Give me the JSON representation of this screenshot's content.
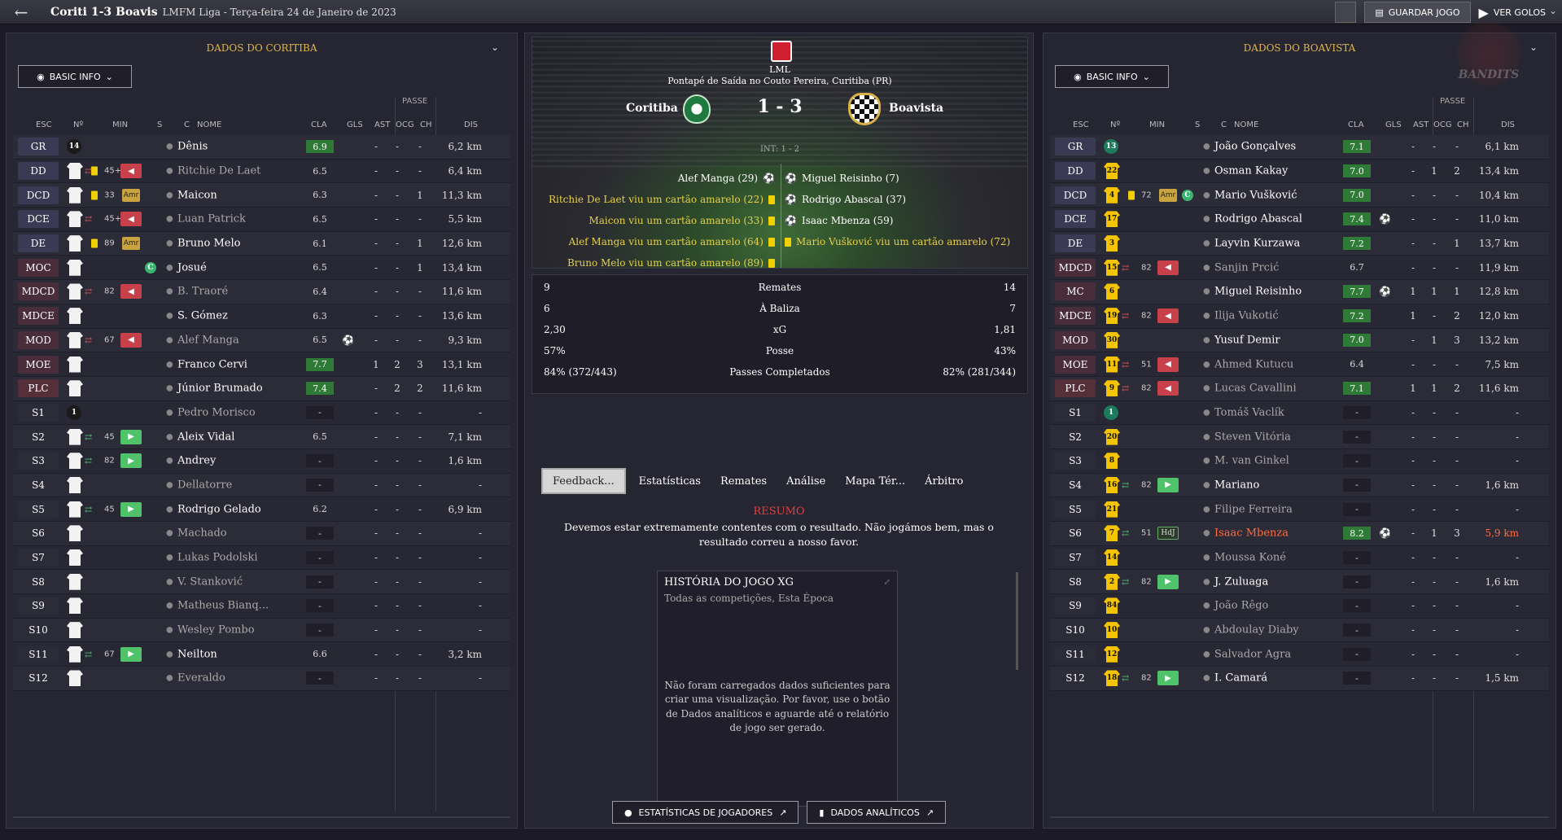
{
  "topbar": {
    "title": "Coriti 1-3 Boavis",
    "subtitle": "LMFM Liga  - Terça-feira 24 de Janeiro de 2023",
    "save_label": "GUARDAR JOGO",
    "goals_label": "VER GOLOS"
  },
  "left": {
    "header": "DADOS DO CORITIBA",
    "basic_info": "BASIC INFO",
    "passe": "PASSE",
    "columns": {
      "esc": "ESC",
      "n": "Nº",
      "min": "MIN",
      "s": "S",
      "c": "C",
      "nome": "NOME",
      "cla": "CLA",
      "gls": "GLS",
      "ast": "AST",
      "ocg": "OCG",
      "ch": "CH",
      "dis": "DIS"
    },
    "players": [
      {
        "pos": "GR",
        "n": "14",
        "shirt": "gk",
        "sub": "",
        "min": "",
        "s": "",
        "c": "",
        "name": "Dênis",
        "cla": "6.9",
        "gls": "",
        "ast": "-",
        "ocg": "-",
        "ch": "-",
        "dis": "6,2 km",
        "posc": "d",
        "rc": "g"
      },
      {
        "pos": "DD",
        "n": "",
        "shirt": "white",
        "sub": "out",
        "min": "45+4",
        "s": "red",
        "c": "",
        "name": "Ritchie De Laet",
        "cla": "6.5",
        "gls": "",
        "ast": "-",
        "ocg": "-",
        "ch": "-",
        "dis": "6,4 km",
        "posc": "d",
        "rc": "n",
        "yc": true,
        "dim": true
      },
      {
        "pos": "DCD",
        "n": "",
        "shirt": "white",
        "sub": "",
        "min": "33",
        "s": "amr",
        "c": "",
        "name": "Maicon",
        "cla": "6.3",
        "gls": "",
        "ast": "-",
        "ocg": "-",
        "ch": "1",
        "dis": "11,3 km",
        "posc": "d",
        "rc": "n",
        "yc": true
      },
      {
        "pos": "DCE",
        "n": "",
        "shirt": "white",
        "sub": "out",
        "min": "45+4",
        "s": "red",
        "c": "",
        "name": "Luan Patrick",
        "cla": "6.5",
        "gls": "",
        "ast": "-",
        "ocg": "-",
        "ch": "-",
        "dis": "5,5 km",
        "posc": "d",
        "rc": "n",
        "dim": true
      },
      {
        "pos": "DE",
        "n": "",
        "shirt": "white",
        "sub": "",
        "min": "89",
        "s": "amr",
        "c": "",
        "name": "Bruno Melo",
        "cla": "6.1",
        "gls": "",
        "ast": "-",
        "ocg": "-",
        "ch": "1",
        "dis": "12,6 km",
        "posc": "d",
        "rc": "n",
        "yc": true
      },
      {
        "pos": "MOC",
        "n": "",
        "shirt": "white",
        "sub": "",
        "min": "",
        "s": "",
        "c": "cap",
        "name": "Josué",
        "cla": "6.5",
        "gls": "",
        "ast": "-",
        "ocg": "-",
        "ch": "1",
        "dis": "13,4 km",
        "posc": "m",
        "rc": "n"
      },
      {
        "pos": "MDCD",
        "n": "",
        "shirt": "white",
        "sub": "out",
        "min": "82",
        "s": "red",
        "c": "",
        "name": "B. Traoré",
        "cla": "6.4",
        "gls": "",
        "ast": "-",
        "ocg": "-",
        "ch": "-",
        "dis": "11,6 km",
        "posc": "m",
        "rc": "n",
        "dim": true
      },
      {
        "pos": "MDCE",
        "n": "",
        "shirt": "white",
        "sub": "",
        "min": "",
        "s": "",
        "c": "",
        "name": "S. Gómez",
        "cla": "6.3",
        "gls": "",
        "ast": "-",
        "ocg": "-",
        "ch": "-",
        "dis": "13,6 km",
        "posc": "m",
        "rc": "n"
      },
      {
        "pos": "MOD",
        "n": "",
        "shirt": "white",
        "sub": "out",
        "min": "67",
        "s": "red",
        "c": "",
        "name": "Alef Manga",
        "cla": "6.5",
        "gls": "ball",
        "ast": "-",
        "ocg": "-",
        "ch": "-",
        "dis": "9,3 km",
        "posc": "m",
        "rc": "n",
        "dim": true
      },
      {
        "pos": "MOE",
        "n": "",
        "shirt": "white",
        "sub": "",
        "min": "",
        "s": "",
        "c": "",
        "name": "Franco Cervi",
        "cla": "7.7",
        "gls": "",
        "ast": "1",
        "ocg": "2",
        "ch": "3",
        "dis": "13,1 km",
        "posc": "m",
        "rc": "g"
      },
      {
        "pos": "PLC",
        "n": "",
        "shirt": "white",
        "sub": "",
        "min": "",
        "s": "",
        "c": "",
        "name": "Júnior Brumado",
        "cla": "7.4",
        "gls": "",
        "ast": "-",
        "ocg": "2",
        "ch": "2",
        "dis": "11,6 km",
        "posc": "a",
        "rc": "g"
      },
      {
        "pos": "S1",
        "n": "1",
        "shirt": "gk",
        "sub": "",
        "min": "",
        "s": "",
        "c": "",
        "name": "Pedro Morisco",
        "cla": "-",
        "gls": "",
        "ast": "-",
        "ocg": "-",
        "ch": "-",
        "dis": "-",
        "posc": "s",
        "rc": "dash",
        "dim": true
      },
      {
        "pos": "S2",
        "n": "",
        "shirt": "white",
        "sub": "in",
        "min": "45",
        "s": "green",
        "c": "",
        "name": "Aleix Vidal",
        "cla": "6.5",
        "gls": "",
        "ast": "-",
        "ocg": "-",
        "ch": "-",
        "dis": "7,1 km",
        "posc": "s",
        "rc": "n"
      },
      {
        "pos": "S3",
        "n": "",
        "shirt": "white",
        "sub": "in",
        "min": "82",
        "s": "green",
        "c": "",
        "name": "Andrey",
        "cla": "-",
        "gls": "",
        "ast": "-",
        "ocg": "-",
        "ch": "-",
        "dis": "1,6 km",
        "posc": "s",
        "rc": "dash"
      },
      {
        "pos": "S4",
        "n": "",
        "shirt": "white",
        "sub": "",
        "min": "",
        "s": "",
        "c": "",
        "name": "Dellatorre",
        "cla": "-",
        "gls": "",
        "ast": "-",
        "ocg": "-",
        "ch": "-",
        "dis": "-",
        "posc": "s",
        "rc": "dash",
        "dim": true
      },
      {
        "pos": "S5",
        "n": "",
        "shirt": "white",
        "sub": "in",
        "min": "45",
        "s": "green",
        "c": "",
        "name": "Rodrigo Gelado",
        "cla": "6.2",
        "gls": "",
        "ast": "-",
        "ocg": "-",
        "ch": "-",
        "dis": "6,9 km",
        "posc": "s",
        "rc": "n"
      },
      {
        "pos": "S6",
        "n": "",
        "shirt": "white",
        "sub": "",
        "min": "",
        "s": "",
        "c": "",
        "name": "Machado",
        "cla": "-",
        "gls": "",
        "ast": "-",
        "ocg": "-",
        "ch": "-",
        "dis": "-",
        "posc": "s",
        "rc": "dash",
        "dim": true
      },
      {
        "pos": "S7",
        "n": "",
        "shirt": "white",
        "sub": "",
        "min": "",
        "s": "",
        "c": "",
        "name": "Lukas Podolski",
        "cla": "-",
        "gls": "",
        "ast": "-",
        "ocg": "-",
        "ch": "-",
        "dis": "-",
        "posc": "s",
        "rc": "dash",
        "dim": true
      },
      {
        "pos": "S8",
        "n": "",
        "shirt": "white",
        "sub": "",
        "min": "",
        "s": "",
        "c": "",
        "name": "V. Stanković",
        "cla": "-",
        "gls": "",
        "ast": "-",
        "ocg": "-",
        "ch": "-",
        "dis": "-",
        "posc": "s",
        "rc": "dash",
        "dim": true
      },
      {
        "pos": "S9",
        "n": "",
        "shirt": "white",
        "sub": "",
        "min": "",
        "s": "",
        "c": "",
        "name": "Matheus Bianq...",
        "cla": "-",
        "gls": "",
        "ast": "-",
        "ocg": "-",
        "ch": "-",
        "dis": "-",
        "posc": "s",
        "rc": "dash",
        "dim": true
      },
      {
        "pos": "S10",
        "n": "",
        "shirt": "white",
        "sub": "",
        "min": "",
        "s": "",
        "c": "",
        "name": "Wesley Pombo",
        "cla": "-",
        "gls": "",
        "ast": "-",
        "ocg": "-",
        "ch": "-",
        "dis": "-",
        "posc": "s",
        "rc": "dash",
        "dim": true
      },
      {
        "pos": "S11",
        "n": "",
        "shirt": "white",
        "sub": "in",
        "min": "67",
        "s": "green",
        "c": "",
        "name": "Neilton",
        "cla": "6.6",
        "gls": "",
        "ast": "-",
        "ocg": "-",
        "ch": "-",
        "dis": "3,2 km",
        "posc": "s",
        "rc": "n"
      },
      {
        "pos": "S12",
        "n": "",
        "shirt": "white",
        "sub": "",
        "min": "",
        "s": "",
        "c": "",
        "name": "Everaldo",
        "cla": "-",
        "gls": "",
        "ast": "-",
        "ocg": "-",
        "ch": "-",
        "dis": "-",
        "posc": "s",
        "rc": "dash",
        "dim": true
      }
    ]
  },
  "right": {
    "header": "DADOS DO BOAVISTA",
    "basic_info": "BASIC INFO",
    "passe": "PASSE",
    "players": [
      {
        "pos": "GR",
        "n": "13",
        "shirt": "gk-green",
        "sub": "",
        "min": "",
        "s": "",
        "c": "",
        "name": "João Gonçalves",
        "cla": "7.1",
        "gls": "",
        "ast": "-",
        "ocg": "-",
        "ch": "-",
        "dis": "6,1 km",
        "posc": "d",
        "rc": "g"
      },
      {
        "pos": "DD",
        "n": "22",
        "shirt": "yellow",
        "sub": "",
        "min": "",
        "s": "",
        "c": "",
        "name": "Osman Kakay",
        "cla": "7.0",
        "gls": "",
        "ast": "-",
        "ocg": "1",
        "ch": "2",
        "dis": "13,4 km",
        "posc": "d",
        "rc": "g"
      },
      {
        "pos": "DCD",
        "n": "4",
        "shirt": "yellow",
        "sub": "",
        "min": "72",
        "s": "amr",
        "c": "cap",
        "name": "Mario Vušković",
        "cla": "7.0",
        "gls": "",
        "ast": "-",
        "ocg": "-",
        "ch": "-",
        "dis": "10,4 km",
        "posc": "d",
        "rc": "g",
        "yc": true
      },
      {
        "pos": "DCE",
        "n": "17",
        "shirt": "yellow",
        "sub": "",
        "min": "",
        "s": "",
        "c": "",
        "name": "Rodrigo Abascal",
        "cla": "7.4",
        "gls": "ball",
        "ast": "-",
        "ocg": "-",
        "ch": "-",
        "dis": "11,0 km",
        "posc": "d",
        "rc": "g"
      },
      {
        "pos": "DE",
        "n": "3",
        "shirt": "yellow",
        "sub": "",
        "min": "",
        "s": "",
        "c": "",
        "name": "Layvin Kurzawa",
        "cla": "7.2",
        "gls": "",
        "ast": "-",
        "ocg": "-",
        "ch": "1",
        "dis": "13,7 km",
        "posc": "d",
        "rc": "g"
      },
      {
        "pos": "MDCD",
        "n": "15",
        "shirt": "yellow",
        "sub": "out",
        "min": "82",
        "s": "red",
        "c": "",
        "name": "Sanjin Prcić",
        "cla": "6.7",
        "gls": "",
        "ast": "-",
        "ocg": "-",
        "ch": "-",
        "dis": "11,9 km",
        "posc": "m",
        "rc": "n",
        "dim": true
      },
      {
        "pos": "MC",
        "n": "6",
        "shirt": "yellow",
        "sub": "",
        "min": "",
        "s": "",
        "c": "",
        "name": "Miguel Reisinho",
        "cla": "7.7",
        "gls": "ball",
        "ast": "1",
        "ocg": "1",
        "ch": "1",
        "dis": "12,8 km",
        "posc": "m",
        "rc": "g"
      },
      {
        "pos": "MDCE",
        "n": "19",
        "shirt": "yellow",
        "sub": "out",
        "min": "82",
        "s": "red",
        "c": "",
        "name": "Ilija Vukotić",
        "cla": "7.2",
        "gls": "",
        "ast": "1",
        "ocg": "-",
        "ch": "2",
        "dis": "12,0 km",
        "posc": "m",
        "rc": "g",
        "dim": true
      },
      {
        "pos": "MOD",
        "n": "30",
        "shirt": "yellow",
        "sub": "",
        "min": "",
        "s": "",
        "c": "",
        "name": "Yusuf Demir",
        "cla": "7.0",
        "gls": "",
        "ast": "-",
        "ocg": "1",
        "ch": "3",
        "dis": "13,2 km",
        "posc": "m",
        "rc": "g"
      },
      {
        "pos": "MOE",
        "n": "11",
        "shirt": "yellow",
        "sub": "out",
        "min": "51",
        "s": "red",
        "c": "",
        "name": "Ahmed Kutucu",
        "cla": "6.4",
        "gls": "",
        "ast": "-",
        "ocg": "-",
        "ch": "-",
        "dis": "7,5 km",
        "posc": "m",
        "rc": "n",
        "dim": true
      },
      {
        "pos": "PLC",
        "n": "9",
        "shirt": "yellow",
        "sub": "out",
        "min": "82",
        "s": "red",
        "c": "",
        "name": "Lucas Cavallini",
        "cla": "7.1",
        "gls": "",
        "ast": "1",
        "ocg": "1",
        "ch": "2",
        "dis": "11,6 km",
        "posc": "a",
        "rc": "g",
        "dim": true
      },
      {
        "pos": "S1",
        "n": "1",
        "shirt": "gk-green",
        "sub": "",
        "min": "",
        "s": "",
        "c": "",
        "name": "Tomáš Vaclík",
        "cla": "-",
        "gls": "",
        "ast": "-",
        "ocg": "-",
        "ch": "-",
        "dis": "-",
        "posc": "s",
        "rc": "dash",
        "dim": true
      },
      {
        "pos": "S2",
        "n": "20",
        "shirt": "yellow",
        "sub": "",
        "min": "",
        "s": "",
        "c": "",
        "name": "Steven Vitória",
        "cla": "-",
        "gls": "",
        "ast": "-",
        "ocg": "-",
        "ch": "-",
        "dis": "-",
        "posc": "s",
        "rc": "dash",
        "dim": true
      },
      {
        "pos": "S3",
        "n": "8",
        "shirt": "yellow",
        "sub": "",
        "min": "",
        "s": "",
        "c": "",
        "name": "M. van Ginkel",
        "cla": "-",
        "gls": "",
        "ast": "-",
        "ocg": "-",
        "ch": "-",
        "dis": "-",
        "posc": "s",
        "rc": "dash",
        "dim": true
      },
      {
        "pos": "S4",
        "n": "16",
        "shirt": "yellow",
        "sub": "in",
        "min": "82",
        "s": "green",
        "c": "",
        "name": "Mariano",
        "cla": "-",
        "gls": "",
        "ast": "-",
        "ocg": "-",
        "ch": "-",
        "dis": "1,6 km",
        "posc": "s",
        "rc": "dash"
      },
      {
        "pos": "S5",
        "n": "21",
        "shirt": "yellow",
        "sub": "",
        "min": "",
        "s": "",
        "c": "",
        "name": "Filipe Ferreira",
        "cla": "-",
        "gls": "",
        "ast": "-",
        "ocg": "-",
        "ch": "-",
        "dis": "-",
        "posc": "s",
        "rc": "dash",
        "dim": true
      },
      {
        "pos": "S6",
        "n": "7",
        "shirt": "yellow",
        "sub": "in",
        "min": "51",
        "s": "hdj",
        "c": "",
        "name": "Isaac Mbenza",
        "cla": "8.2",
        "gls": "ball",
        "ast": "-",
        "ocg": "1",
        "ch": "3",
        "dis": "5,9 km",
        "posc": "s",
        "rc": "g",
        "red": true
      },
      {
        "pos": "S7",
        "n": "14",
        "shirt": "yellow",
        "sub": "",
        "min": "",
        "s": "",
        "c": "",
        "name": "Moussa Koné",
        "cla": "-",
        "gls": "",
        "ast": "-",
        "ocg": "-",
        "ch": "-",
        "dis": "-",
        "posc": "s",
        "rc": "dash",
        "dim": true
      },
      {
        "pos": "S8",
        "n": "2",
        "shirt": "yellow",
        "sub": "in",
        "min": "82",
        "s": "green",
        "c": "",
        "name": "J. Zuluaga",
        "cla": "-",
        "gls": "",
        "ast": "-",
        "ocg": "-",
        "ch": "-",
        "dis": "1,6 km",
        "posc": "s",
        "rc": "dash"
      },
      {
        "pos": "S9",
        "n": "84",
        "shirt": "yellow",
        "sub": "",
        "min": "",
        "s": "",
        "c": "",
        "name": "João Rêgo",
        "cla": "-",
        "gls": "",
        "ast": "-",
        "ocg": "-",
        "ch": "-",
        "dis": "-",
        "posc": "s",
        "rc": "dash",
        "dim": true
      },
      {
        "pos": "S10",
        "n": "10",
        "shirt": "yellow",
        "sub": "",
        "min": "",
        "s": "",
        "c": "",
        "name": "Abdoulay Diaby",
        "cla": "-",
        "gls": "",
        "ast": "-",
        "ocg": "-",
        "ch": "-",
        "dis": "-",
        "posc": "s",
        "rc": "dash",
        "dim": true
      },
      {
        "pos": "S11",
        "n": "12",
        "shirt": "yellow",
        "sub": "",
        "min": "",
        "s": "",
        "c": "",
        "name": "Salvador Agra",
        "cla": "-",
        "gls": "",
        "ast": "-",
        "ocg": "-",
        "ch": "-",
        "dis": "-",
        "posc": "s",
        "rc": "dash",
        "dim": true
      },
      {
        "pos": "S12",
        "n": "18",
        "shirt": "yellow",
        "sub": "in",
        "min": "82",
        "s": "green",
        "c": "",
        "name": "I. Camará",
        "cla": "-",
        "gls": "",
        "ast": "-",
        "ocg": "-",
        "ch": "-",
        "dis": "1,5 km",
        "posc": "s",
        "rc": "dash"
      }
    ]
  },
  "match": {
    "league": "LML",
    "kickoff": "Pontapé de Saída no Couto Pereira, Curitiba (PR)",
    "home": "Coritiba",
    "away": "Boavista",
    "score": "1 - 3",
    "ht": "INT: 1 - 2",
    "events_home": [
      {
        "text": "Alef Manga (29)",
        "type": "goal"
      },
      {
        "text": "Ritchie De Laet viu um cartão amarelo (22)",
        "type": "card"
      },
      {
        "text": "Maicon viu um cartão amarelo (33)",
        "type": "card"
      },
      {
        "text": "Alef Manga viu um cartão amarelo (64)",
        "type": "card"
      },
      {
        "text": "Bruno Melo viu um cartão amarelo (89)",
        "type": "card"
      }
    ],
    "events_away": [
      {
        "text": "Miguel Reisinho (7)",
        "type": "goal"
      },
      {
        "text": "Rodrigo Abascal (37)",
        "type": "goal"
      },
      {
        "text": "Isaac Mbenza (59)",
        "type": "goal"
      },
      {
        "text": "Mario Vušković viu um cartão amarelo (72)",
        "type": "card"
      }
    ]
  },
  "stats": [
    {
      "l": "9",
      "label": "Remates",
      "r": "14"
    },
    {
      "l": "6",
      "label": "À Baliza",
      "r": "7"
    },
    {
      "l": "2,30",
      "label": "xG",
      "r": "1,81"
    },
    {
      "l": "57%",
      "label": "Posse",
      "r": "43%"
    },
    {
      "l": "84% (372/443)",
      "label": "Passes Completados",
      "r": "82% (281/344)"
    }
  ],
  "tabs": [
    "Feedback...",
    "Estatísticas",
    "Remates",
    "Análise",
    "Mapa Tér...",
    "Árbitro"
  ],
  "resumo": {
    "title": "RESUMO",
    "text": "Devemos estar extremamente contentes com o resultado. Não jogámos bem, mas o resultado correu a nosso favor."
  },
  "xg": {
    "title": "HISTÓRIA DO JOGO XG",
    "subtitle": "Todas as competições, Esta Época",
    "empty": "Não foram carregados dados suficientes para criar uma visualização. Por favor, use o botão de Dados analíticos e aguarde até o relatório de jogo ser gerado."
  },
  "buttons": {
    "player_stats": "ESTATÍSTICAS DE JOGADORES",
    "analytics": "DADOS ANALÍTICOS"
  },
  "watermark": "BANDITS"
}
